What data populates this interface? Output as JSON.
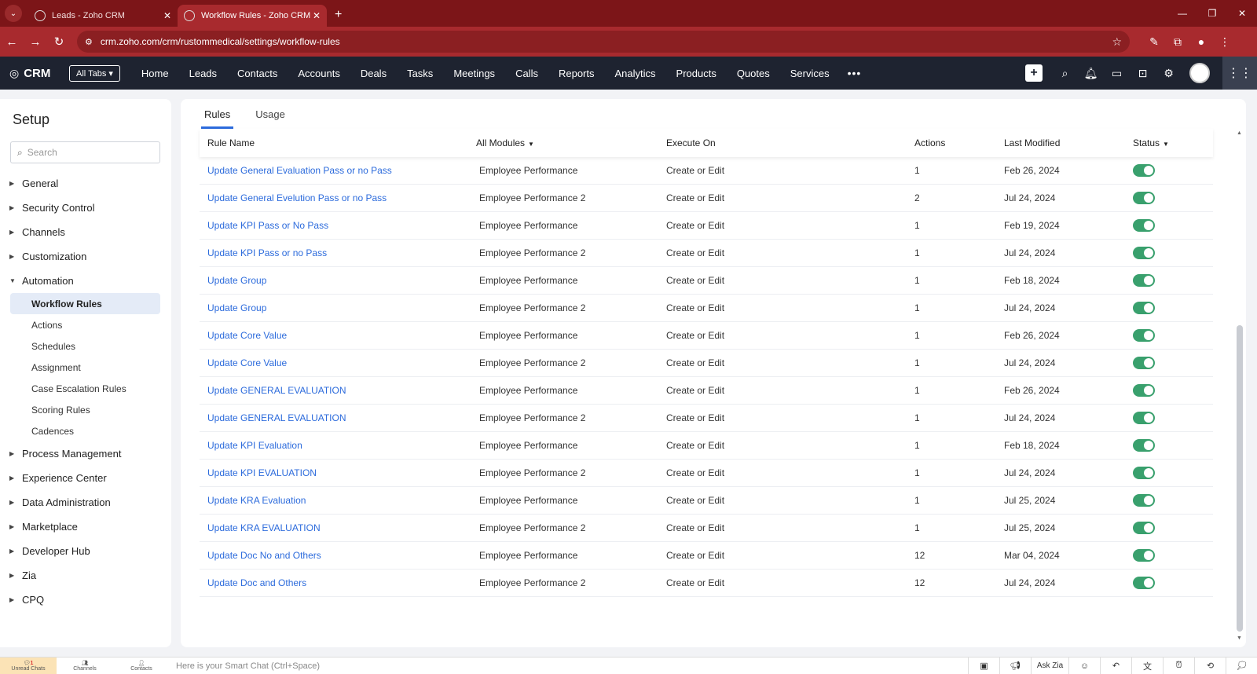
{
  "browser": {
    "tabs": [
      {
        "title": "Leads - Zoho CRM",
        "active": false
      },
      {
        "title": "Workflow Rules - Zoho CRM",
        "active": true
      }
    ],
    "url": "crm.zoho.com/crm/rustommedical/settings/workflow-rules"
  },
  "crm": {
    "logo_text": "CRM",
    "all_tabs_label": "All Tabs",
    "nav_items": [
      "Home",
      "Leads",
      "Contacts",
      "Accounts",
      "Deals",
      "Tasks",
      "Meetings",
      "Calls",
      "Reports",
      "Analytics",
      "Products",
      "Quotes",
      "Services"
    ],
    "more_label": "•••"
  },
  "sidebar": {
    "title": "Setup",
    "search_placeholder": "Search",
    "sections": [
      {
        "label": "General",
        "expanded": false
      },
      {
        "label": "Security Control",
        "expanded": false
      },
      {
        "label": "Channels",
        "expanded": false
      },
      {
        "label": "Customization",
        "expanded": false
      },
      {
        "label": "Automation",
        "expanded": true
      },
      {
        "label": "Process Management",
        "expanded": false
      },
      {
        "label": "Experience Center",
        "expanded": false
      },
      {
        "label": "Data Administration",
        "expanded": false
      },
      {
        "label": "Marketplace",
        "expanded": false
      },
      {
        "label": "Developer Hub",
        "expanded": false
      },
      {
        "label": "Zia",
        "expanded": false
      },
      {
        "label": "CPQ",
        "expanded": false
      }
    ],
    "automation_items": [
      "Workflow Rules",
      "Actions",
      "Schedules",
      "Assignment",
      "Case Escalation Rules",
      "Scoring Rules",
      "Cadences"
    ],
    "active_item": "Workflow Rules"
  },
  "main": {
    "tabs": [
      "Rules",
      "Usage"
    ],
    "active_tab": "Rules",
    "columns": {
      "rule_name": "Rule Name",
      "module": "All Modules",
      "execute_on": "Execute On",
      "actions": "Actions",
      "last_modified": "Last Modified",
      "status": "Status"
    },
    "rows": [
      {
        "name": "Update General Evaluation Pass or no Pass",
        "module": "Employee Performance",
        "execute": "Create or Edit",
        "actions": "1",
        "modified": "Feb 26, 2024",
        "status": true
      },
      {
        "name": "Update General Evelution Pass or no Pass",
        "module": "Employee Performance 2",
        "execute": "Create or Edit",
        "actions": "2",
        "modified": "Jul 24, 2024",
        "status": true
      },
      {
        "name": "Update KPI Pass or No Pass",
        "module": "Employee Performance",
        "execute": "Create or Edit",
        "actions": "1",
        "modified": "Feb 19, 2024",
        "status": true
      },
      {
        "name": "Update KPI Pass or no Pass",
        "module": "Employee Performance 2",
        "execute": "Create or Edit",
        "actions": "1",
        "modified": "Jul 24, 2024",
        "status": true
      },
      {
        "name": "Update Group",
        "module": "Employee Performance",
        "execute": "Create or Edit",
        "actions": "1",
        "modified": "Feb 18, 2024",
        "status": true
      },
      {
        "name": "Update Group",
        "module": "Employee Performance 2",
        "execute": "Create or Edit",
        "actions": "1",
        "modified": "Jul 24, 2024",
        "status": true
      },
      {
        "name": "Update Core Value",
        "module": "Employee Performance",
        "execute": "Create or Edit",
        "actions": "1",
        "modified": "Feb 26, 2024",
        "status": true
      },
      {
        "name": "Update Core Value",
        "module": "Employee Performance 2",
        "execute": "Create or Edit",
        "actions": "1",
        "modified": "Jul 24, 2024",
        "status": true
      },
      {
        "name": "Update GENERAL EVALUATION",
        "module": "Employee Performance",
        "execute": "Create or Edit",
        "actions": "1",
        "modified": "Feb 26, 2024",
        "status": true
      },
      {
        "name": "Update GENERAL EVALUATION",
        "module": "Employee Performance 2",
        "execute": "Create or Edit",
        "actions": "1",
        "modified": "Jul 24, 2024",
        "status": true
      },
      {
        "name": "Update KPI Evaluation",
        "module": "Employee Performance",
        "execute": "Create or Edit",
        "actions": "1",
        "modified": "Feb 18, 2024",
        "status": true
      },
      {
        "name": "Update KPI EVALUATION",
        "module": "Employee Performance 2",
        "execute": "Create or Edit",
        "actions": "1",
        "modified": "Jul 24, 2024",
        "status": true
      },
      {
        "name": "Update KRA Evaluation",
        "module": "Employee Performance",
        "execute": "Create or Edit",
        "actions": "1",
        "modified": "Jul 25, 2024",
        "status": true
      },
      {
        "name": "Update KRA EVALUATION",
        "module": "Employee Performance 2",
        "execute": "Create or Edit",
        "actions": "1",
        "modified": "Jul 25, 2024",
        "status": true
      },
      {
        "name": "Update Doc No and Others",
        "module": "Employee Performance",
        "execute": "Create or Edit",
        "actions": "12",
        "modified": "Mar 04, 2024",
        "status": true
      },
      {
        "name": "Update Doc and Others",
        "module": "Employee Performance 2",
        "execute": "Create or Edit",
        "actions": "12",
        "modified": "Jul 24, 2024",
        "status": true
      }
    ]
  },
  "bottombar": {
    "left_items": [
      "Unread Chats",
      "Channels",
      "Contacts"
    ],
    "unread_badge": "1",
    "smart_chat_placeholder": "Here is your Smart Chat (Ctrl+Space)",
    "ask_zia": "Ask Zia"
  },
  "colors": {
    "browser_frame": "#7c1518",
    "address_bar": "#a82a2e",
    "crm_nav": "#1e2330",
    "link": "#2c6bdc",
    "toggle_on": "#39a06d"
  }
}
